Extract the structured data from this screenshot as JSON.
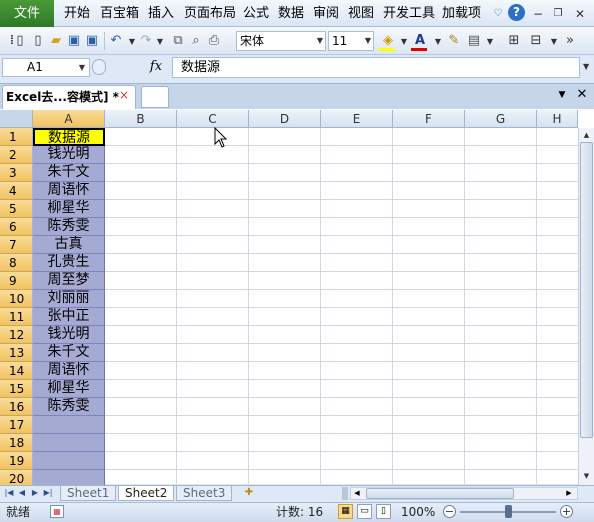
{
  "menu": {
    "file": "文件",
    "items": [
      "开始",
      "百宝箱",
      "插入",
      "页面布局",
      "公式",
      "数据",
      "审阅",
      "视图",
      "开发工具",
      "加载项"
    ]
  },
  "toolbar": {
    "font_name": "宋体",
    "font_size": "11"
  },
  "formula_bar": {
    "cell_ref": "A1",
    "fx": "fx",
    "content": "数据源"
  },
  "doc_tab": {
    "title": "Excel去...容模式] *",
    "close": "×"
  },
  "grid": {
    "columns": [
      "A",
      "B",
      "C",
      "D",
      "E",
      "F",
      "G",
      "H"
    ],
    "rows": [
      "1",
      "2",
      "3",
      "4",
      "5",
      "6",
      "7",
      "8",
      "9",
      "10",
      "11",
      "12",
      "13",
      "14",
      "15",
      "16",
      "17",
      "18",
      "19",
      "20"
    ],
    "colA": [
      "数据源",
      "钱光明",
      "朱千文",
      "周语怀",
      "柳星华",
      "陈秀雯",
      "古真",
      "孔贵生",
      "周至梦",
      "刘丽丽",
      "张中正",
      "钱光明",
      "朱千文",
      "周语怀",
      "柳星华",
      "陈秀雯",
      "",
      "",
      "",
      ""
    ]
  },
  "sheet_tabs": [
    "Sheet1",
    "Sheet2",
    "Sheet3"
  ],
  "active_sheet": "Sheet2",
  "status": {
    "ready": "就绪",
    "count": "计数: 16",
    "zoom": "100%",
    "zoom_minus": "−",
    "zoom_plus": "+"
  },
  "colors": {
    "highlight": "#ffff00",
    "data_fill": "#a5aad3",
    "ribbon_file": "#3a8a2f",
    "header_selected": "#f4c867"
  }
}
